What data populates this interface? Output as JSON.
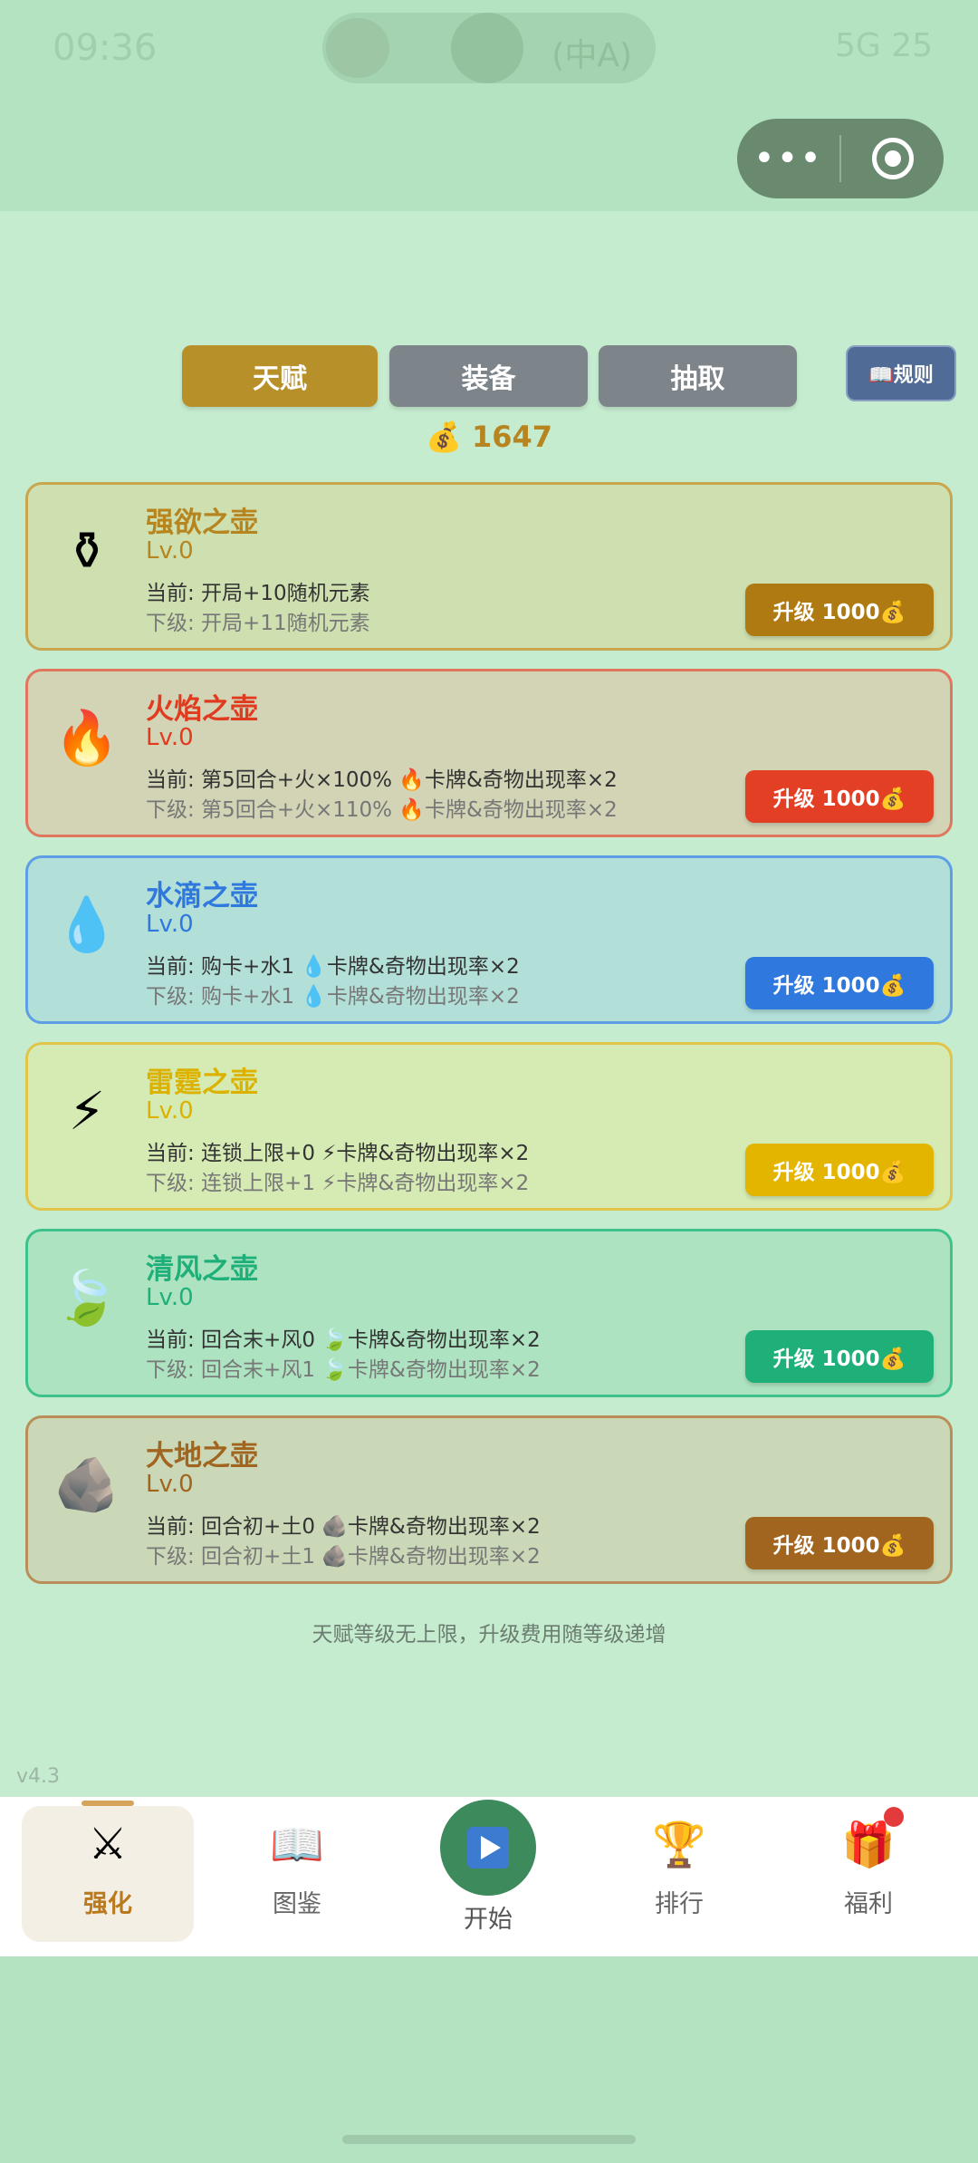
{
  "status_bar": {
    "time": "09:36",
    "right": "5G 25"
  },
  "top_pill": {
    "text": "(中A)"
  },
  "capsule": {
    "more": "•••"
  },
  "tabs": {
    "talent": "天赋",
    "equipment": "装备",
    "draw": "抽取"
  },
  "rules_label": "📖规则",
  "coins": "💰 1647",
  "cards": [
    {
      "icon": "⚱",
      "title": "强欲之壶",
      "level": "Lv.0",
      "current": "当前: 开局+10随机元素",
      "next": "下级: 开局+11随机元素",
      "button": "升级 1000💰",
      "color": "#b07a12"
    },
    {
      "icon": "🔥",
      "title": "火焰之壶",
      "level": "Lv.0",
      "current": "当前: 第5回合+火×100% 🔥卡牌&奇物出现率×2",
      "next": "下级: 第5回合+火×110% 🔥卡牌&奇物出现率×2",
      "button": "升级 1000💰",
      "color": "#e33f24"
    },
    {
      "icon": "💧",
      "title": "水滴之壶",
      "level": "Lv.0",
      "current": "当前: 购卡+水1 💧卡牌&奇物出现率×2",
      "next": "下级: 购卡+水1 💧卡牌&奇物出现率×2",
      "button": "升级 1000💰",
      "color": "#2f78dd"
    },
    {
      "icon": "⚡",
      "title": "雷霆之壶",
      "level": "Lv.0",
      "current": "当前: 连锁上限+0 ⚡卡牌&奇物出现率×2",
      "next": "下级: 连锁上限+1 ⚡卡牌&奇物出现率×2",
      "button": "升级 1000💰",
      "color": "#e3b500"
    },
    {
      "icon": "🍃",
      "title": "清风之壶",
      "level": "Lv.0",
      "current": "当前: 回合末+风0 🍃卡牌&奇物出现率×2",
      "next": "下级: 回合末+风1 🍃卡牌&奇物出现率×2",
      "button": "升级 1000💰",
      "color": "#1fb07a"
    },
    {
      "icon": "🪨",
      "title": "大地之壶",
      "level": "Lv.0",
      "current": "当前: 回合初+土0 🪨卡牌&奇物出现率×2",
      "next": "下级: 回合初+土1 🪨卡牌&奇物出现率×2",
      "button": "升级 1000💰",
      "color": "#a2651f"
    }
  ],
  "footer_note": "天赋等级无上限，升级费用随等级递增",
  "version": "v4.3",
  "nav": {
    "enhance": "强化",
    "codex": "图鉴",
    "start": "开始",
    "rank": "排行",
    "welfare": "福利"
  }
}
